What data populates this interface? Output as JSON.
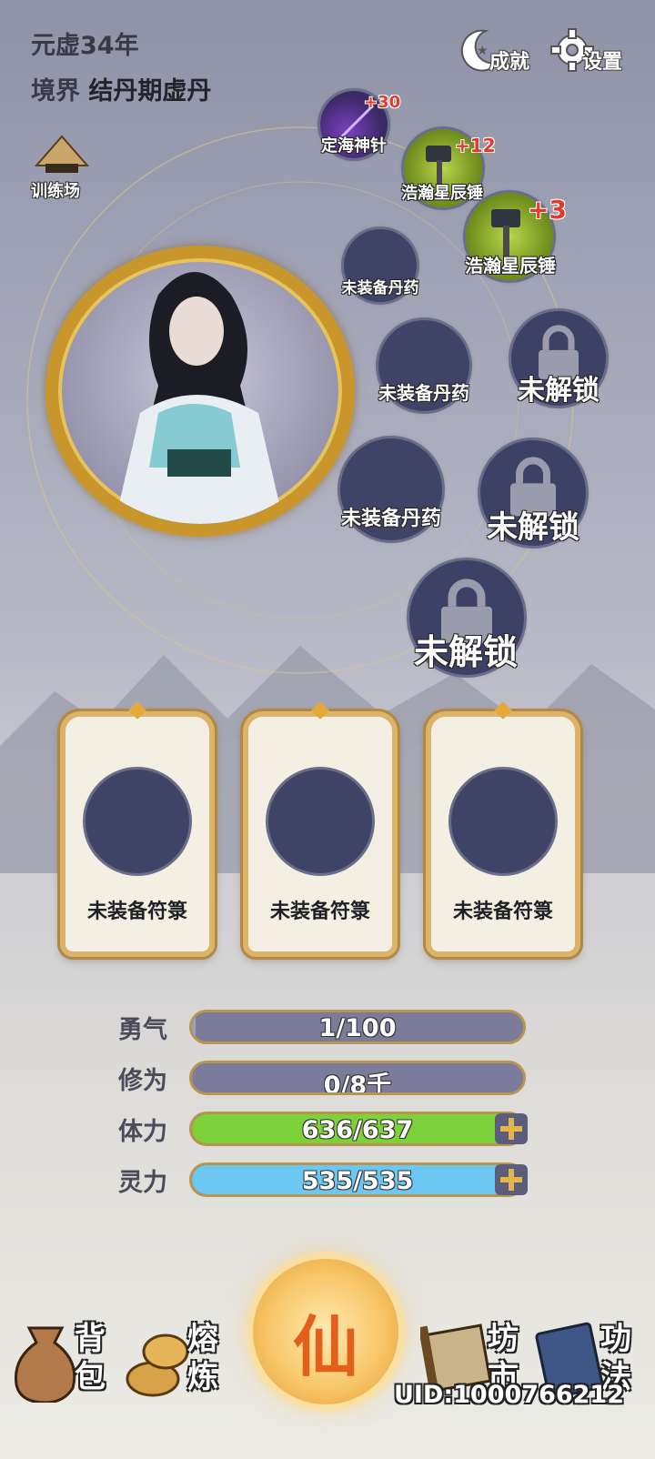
{
  "header": {
    "year": "元虚34年",
    "realm_label": "境界",
    "realm_value": "结丹期虚丹"
  },
  "top_buttons": {
    "achievements": "成就",
    "settings": "设置"
  },
  "training": {
    "label": "训练场"
  },
  "equipment": {
    "weapon1": {
      "name": "定海神针",
      "plus": "+30"
    },
    "weapon2": {
      "name": "浩瀚星辰锤",
      "plus": "+12"
    },
    "weapon3": {
      "name": "浩瀚星辰锤",
      "plus": "+3"
    },
    "pill1": "未装备丹药",
    "pill2": "未装备丹药",
    "pill3": "未装备丹药",
    "locked1": "未解锁",
    "locked2": "未解锁",
    "locked3": "未解锁"
  },
  "talismans": [
    "未装备符箓",
    "未装备符箓",
    "未装备符箓"
  ],
  "stats": {
    "courage": {
      "label": "勇气",
      "value": "1/100",
      "fill": 0.01
    },
    "cultivation": {
      "label": "修为",
      "value": "0/8千",
      "fill": 0.0
    },
    "stamina": {
      "label": "体力",
      "value": "636/637",
      "fill": 0.998
    },
    "spirit": {
      "label": "灵力",
      "value": "535/535",
      "fill": 1.0
    }
  },
  "colors": {
    "stamina": "#7dd13a",
    "spirit": "#6cc7f2",
    "accent_gold": "#c8962a"
  },
  "nav": {
    "bag": [
      "背",
      "包"
    ],
    "smelt": [
      "熔",
      "炼"
    ],
    "center": "仙",
    "market": [
      "坊",
      "市"
    ],
    "skills": [
      "功",
      "法"
    ]
  },
  "uid": "UID:1000766212"
}
